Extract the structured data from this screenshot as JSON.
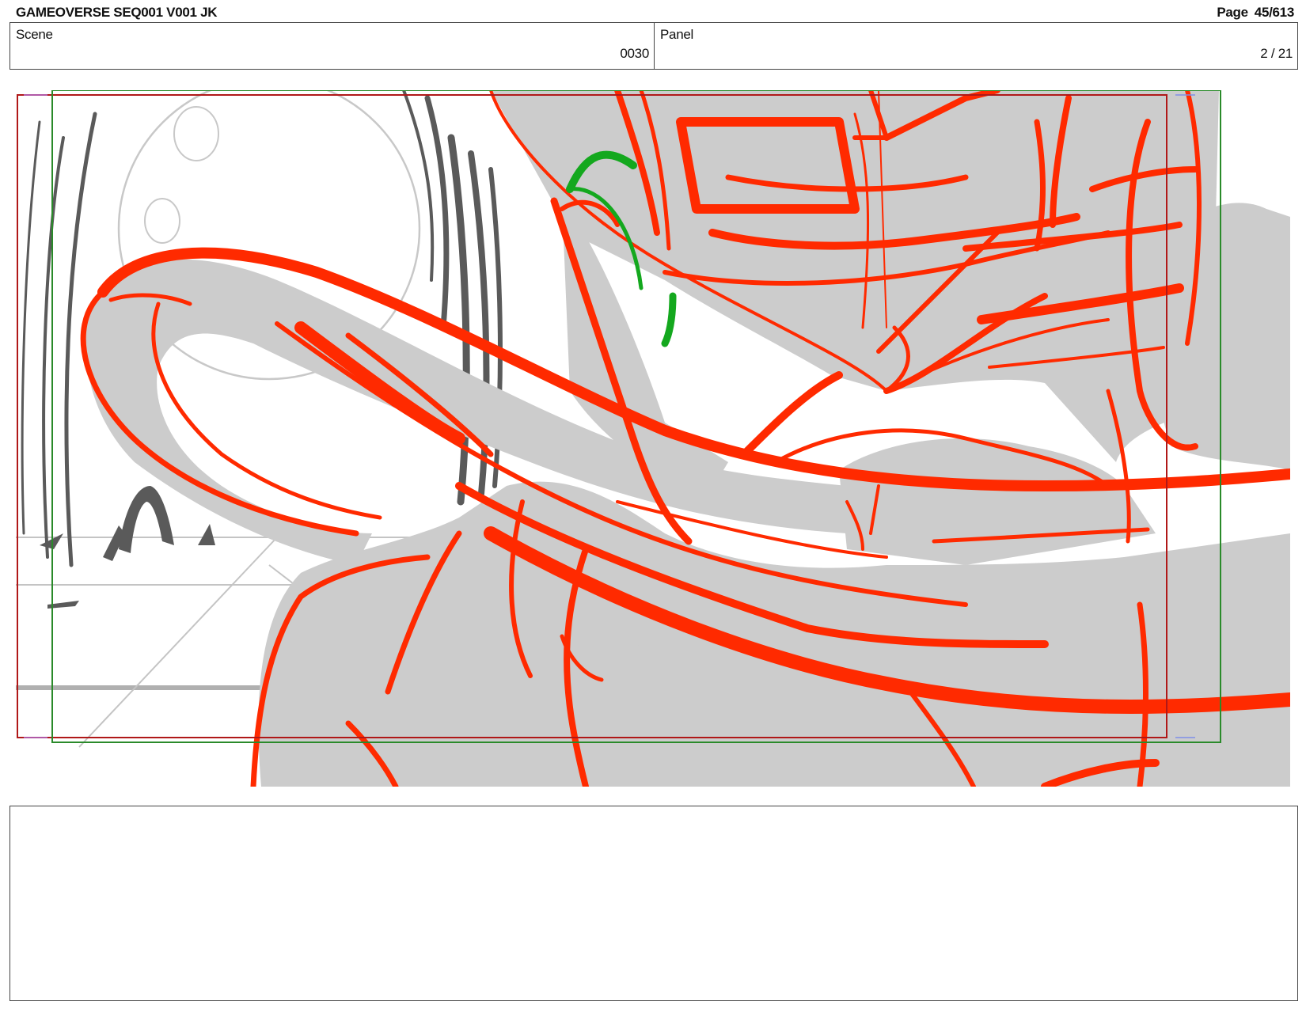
{
  "header": {
    "title": "GAMEOVERSE SEQ001 V001 JK",
    "page_label": "Page",
    "page_value": "45/613"
  },
  "info": {
    "scene_label": "Scene",
    "scene_value": "0030",
    "panel_label": "Panel",
    "panel_value": "2 / 21"
  },
  "panel_image": {
    "description_icon": "storyboard-sketch",
    "colors": {
      "line_red": "#ff2a00",
      "line_green": "#14a81e",
      "fill_grey": "#cccccc",
      "bg_sketch": "#555555",
      "frame_red": "#b01818",
      "frame_green": "#2a8a2a"
    }
  },
  "notes": {
    "text": ""
  }
}
